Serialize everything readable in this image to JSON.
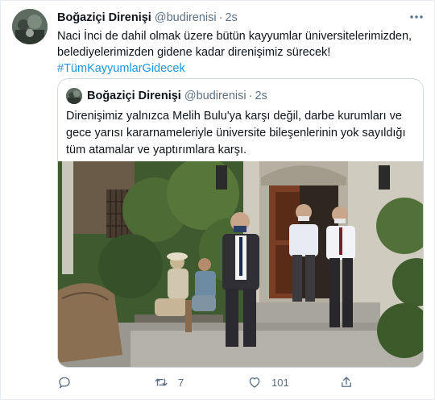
{
  "tweet": {
    "author_name": "Boğaziçi Direnişi",
    "handle": "@budirenisi",
    "separator": "·",
    "time": "2s",
    "text_line1": "Naci İnci de dahil olmak üzere bütün kayyumlar üniversitelerimizden,",
    "text_line2": "belediyelerimizden gidene kadar direnişimiz sürecek!",
    "hashtag": "#TümKayyumlarGidecek"
  },
  "quoted_tweet": {
    "author_name": "Boğaziçi Direnişi",
    "handle": "@budirenisi",
    "separator": "·",
    "time": "2s",
    "text": "Direnişimiz yalnızca Melih Bulu'ya karşı değil, darbe kurumları ve gece yarısı kararnameleriyle üniversite bileşenlerinin yok sayıldığı tüm atamalar ve yaptırımlara karşı."
  },
  "actions": {
    "reply_count": "",
    "retweet_count": "7",
    "like_count": "101"
  },
  "icons": {
    "more": "more-options-icon",
    "reply": "reply-icon",
    "retweet": "retweet-icon",
    "like": "like-icon",
    "share": "share-icon"
  },
  "colors": {
    "link": "#1b95e0",
    "secondary_text": "#5b7083",
    "primary_text": "#0f1419",
    "border": "#cfd9de"
  }
}
